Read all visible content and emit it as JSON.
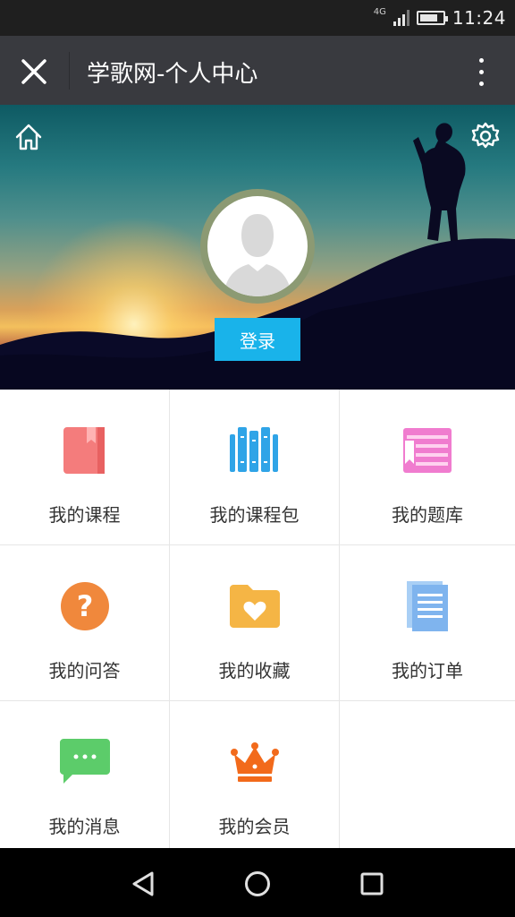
{
  "status": {
    "network": "4G",
    "time": "11:24"
  },
  "titlebar": {
    "title": "学歌网-个人中心",
    "close_icon": "close-icon",
    "more_icon": "more-vertical-icon"
  },
  "hero": {
    "login_label": "登录",
    "home_icon": "home-icon",
    "settings_icon": "gear-icon"
  },
  "menu": [
    {
      "label": "我的课程",
      "icon": "book-icon",
      "color": "#f47c7c"
    },
    {
      "label": "我的课程包",
      "icon": "books-stack-icon",
      "color": "#2fa4e7"
    },
    {
      "label": "我的题库",
      "icon": "question-bank-icon",
      "color": "#f07ccf"
    },
    {
      "label": "我的问答",
      "icon": "question-circle-icon",
      "color": "#f0883c"
    },
    {
      "label": "我的收藏",
      "icon": "heart-folder-icon",
      "color": "#f5b545"
    },
    {
      "label": "我的订单",
      "icon": "document-icon",
      "color": "#7fb4ee"
    },
    {
      "label": "我的消息",
      "icon": "chat-bubble-icon",
      "color": "#5ccc6a"
    },
    {
      "label": "我的会员",
      "icon": "crown-icon",
      "color": "#f26a1b"
    }
  ],
  "navbar": {
    "back_icon": "back-triangle-icon",
    "home_icon": "home-circle-icon",
    "recents_icon": "recents-square-icon"
  }
}
